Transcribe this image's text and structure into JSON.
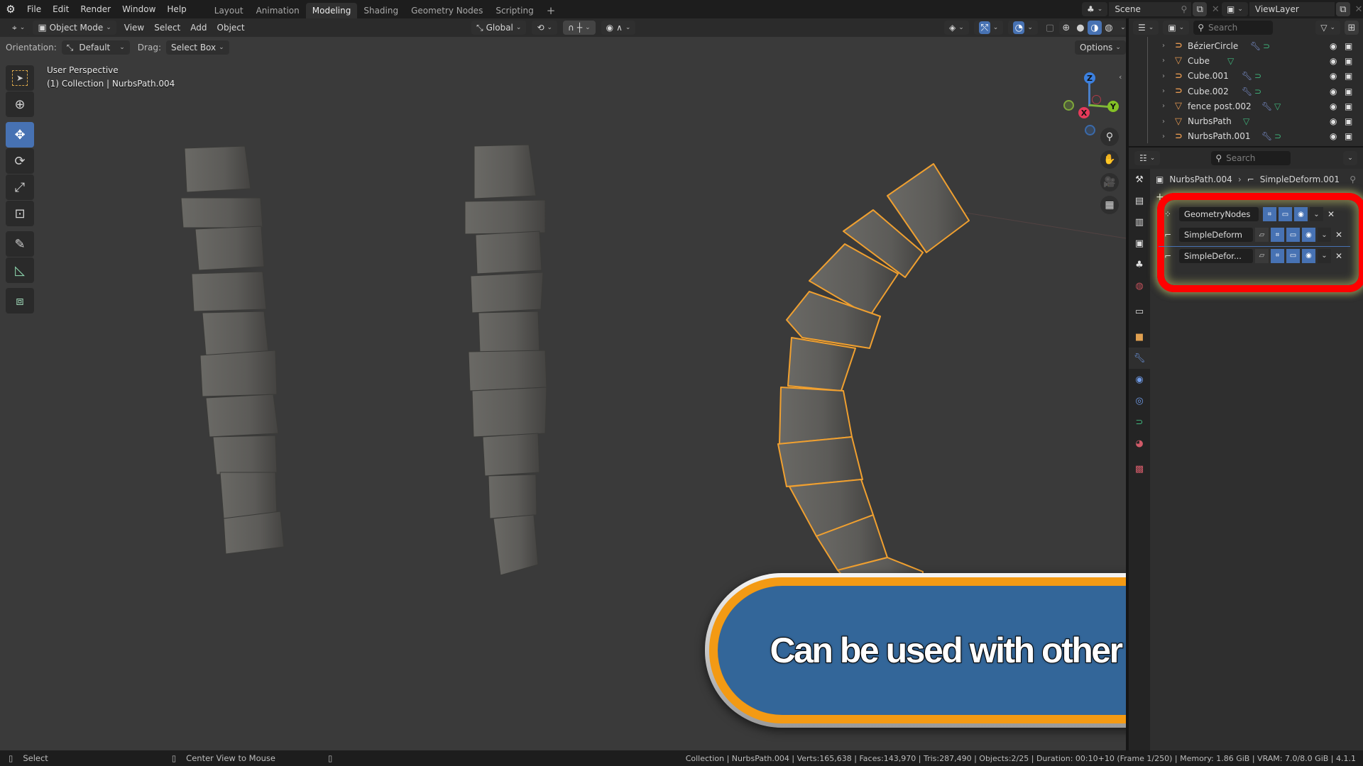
{
  "app": {
    "logo": "blender-logo"
  },
  "menu": [
    "File",
    "Edit",
    "Render",
    "Window",
    "Help"
  ],
  "workspace_tabs": [
    {
      "label": "Layout",
      "active": false
    },
    {
      "label": "Animation",
      "active": false
    },
    {
      "label": "Modeling",
      "active": true
    },
    {
      "label": "Shading",
      "active": false
    },
    {
      "label": "Geometry Nodes",
      "active": false
    },
    {
      "label": "Scripting",
      "active": false
    }
  ],
  "add_workspace": "+",
  "scene": {
    "name": "Scene",
    "view_layer": "ViewLayer"
  },
  "viewport_header": {
    "mode": "Object Mode",
    "menus": [
      "View",
      "Select",
      "Add",
      "Object"
    ],
    "transform_orientation": "Global",
    "options_label": "Options"
  },
  "tool_header": {
    "orientation_label": "Orientation:",
    "orientation_value": "Default",
    "drag_label": "Drag:",
    "drag_value": "Select Box"
  },
  "viewport_info": {
    "perspective": "User Perspective",
    "collection": "(1) Collection | NurbsPath.004"
  },
  "gizmo": {
    "x": "X",
    "y": "Y",
    "z": "Z"
  },
  "outliner": {
    "search_placeholder": "Search",
    "items": [
      {
        "name": "BézierCircle",
        "type": "curve",
        "has_modifier": true,
        "data": "curve"
      },
      {
        "name": "Cube",
        "type": "mesh",
        "has_modifier": false,
        "data": "mesh"
      },
      {
        "name": "Cube.001",
        "type": "curve",
        "has_modifier": true,
        "data": "curve"
      },
      {
        "name": "Cube.002",
        "type": "curve",
        "has_modifier": true,
        "data": "curve"
      },
      {
        "name": "fence post.002",
        "type": "mesh",
        "has_modifier": true,
        "data": "mesh"
      },
      {
        "name": "NurbsPath",
        "type": "mesh",
        "has_modifier": false,
        "data": "mesh"
      },
      {
        "name": "NurbsPath.001",
        "type": "curve",
        "has_modifier": true,
        "data": "curve"
      }
    ]
  },
  "properties": {
    "search_placeholder": "Search",
    "breadcrumb_object": "NurbsPath.004",
    "breadcrumb_modifier": "SimpleDeform.001",
    "active_tab": "modifiers",
    "modifiers": [
      {
        "name": "GeometryNodes",
        "type": "geometry-nodes"
      },
      {
        "name": "SimpleDeform",
        "type": "simple-deform"
      },
      {
        "name": "SimpleDefor...",
        "type": "simple-deform"
      }
    ]
  },
  "status_bar": {
    "left_hint": "Select",
    "middle_hint": "Center View to Mouse",
    "stats": "Collection | NurbsPath.004 | Verts:165,638 | Faces:143,970 | Tris:287,490 | Objects:2/25 | Duration: 00:10+10 (Frame 1/250) | Memory: 1.86 GiB | VRAM: 7.0/8.0 GiB | 4.1.1"
  },
  "caption": {
    "text": "Can be used with other modifiers"
  },
  "colors": {
    "accent_blue": "#4772b3",
    "selection_orange": "#f0a030",
    "highlight_red": "#ff0000",
    "caption_blue": "#336699",
    "caption_orange": "#f39a14"
  }
}
